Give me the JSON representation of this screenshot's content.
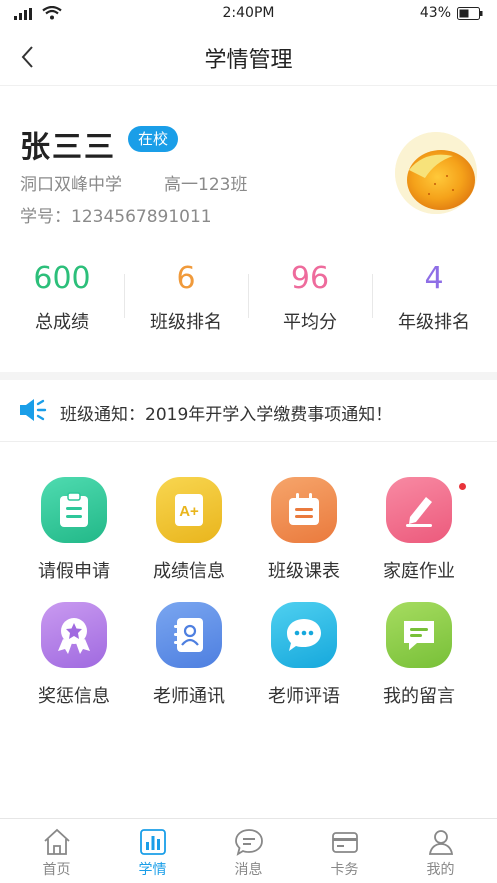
{
  "status_bar": {
    "time": "2:40PM",
    "battery": "43%"
  },
  "nav": {
    "title": "学情管理",
    "back_icon": "chevron-left-icon"
  },
  "profile": {
    "name": "张三三",
    "badge": "在校",
    "school": "洞口双峰中学",
    "class": "高一123班",
    "student_id": "学号：1234567891011",
    "avatar_icon": "mango-avatar"
  },
  "stats": [
    {
      "value": "600",
      "label": "总成绩",
      "color": "#2cbf7a"
    },
    {
      "value": "6",
      "label": "班级排名",
      "color": "#f09a3b"
    },
    {
      "value": "96",
      "label": "平均分",
      "color": "#ee6b9c"
    },
    {
      "value": "4",
      "label": "年级排名",
      "color": "#8e6ee6"
    }
  ],
  "notice": {
    "text": "班级通知：2019年开学入学缴费事项通知！",
    "icon": "speaker-icon"
  },
  "menu": [
    {
      "label": "请假申请",
      "icon": "clipboard-icon",
      "color": "#2ec79a"
    },
    {
      "label": "成绩信息",
      "icon": "grade-a-plus-icon",
      "color": "#f1c534"
    },
    {
      "label": "班级课表",
      "icon": "calendar-icon",
      "color": "#f08b52"
    },
    {
      "label": "家庭作业",
      "icon": "pencil-icon",
      "color": "#f06a8a",
      "has_dot": true
    },
    {
      "label": "奖惩信息",
      "icon": "award-icon",
      "color": "#b57fe6"
    },
    {
      "label": "老师通讯",
      "icon": "contacts-icon",
      "color": "#5e8fe8"
    },
    {
      "label": "老师评语",
      "icon": "chat-bubble-icon",
      "color": "#24b7e6"
    },
    {
      "label": "我的留言",
      "icon": "message-icon",
      "color": "#8ccf4a"
    }
  ],
  "tabs": [
    {
      "label": "首页",
      "icon": "home-icon",
      "active": false
    },
    {
      "label": "学情",
      "icon": "bar-chart-icon",
      "active": true
    },
    {
      "label": "消息",
      "icon": "chat-icon",
      "active": false
    },
    {
      "label": "卡务",
      "icon": "card-icon",
      "active": false
    },
    {
      "label": "我的",
      "icon": "user-icon",
      "active": false
    }
  ],
  "colors": {
    "accent": "#1a9ee8",
    "gray_text": "#8a8a8a",
    "dot": "#e8333a"
  }
}
